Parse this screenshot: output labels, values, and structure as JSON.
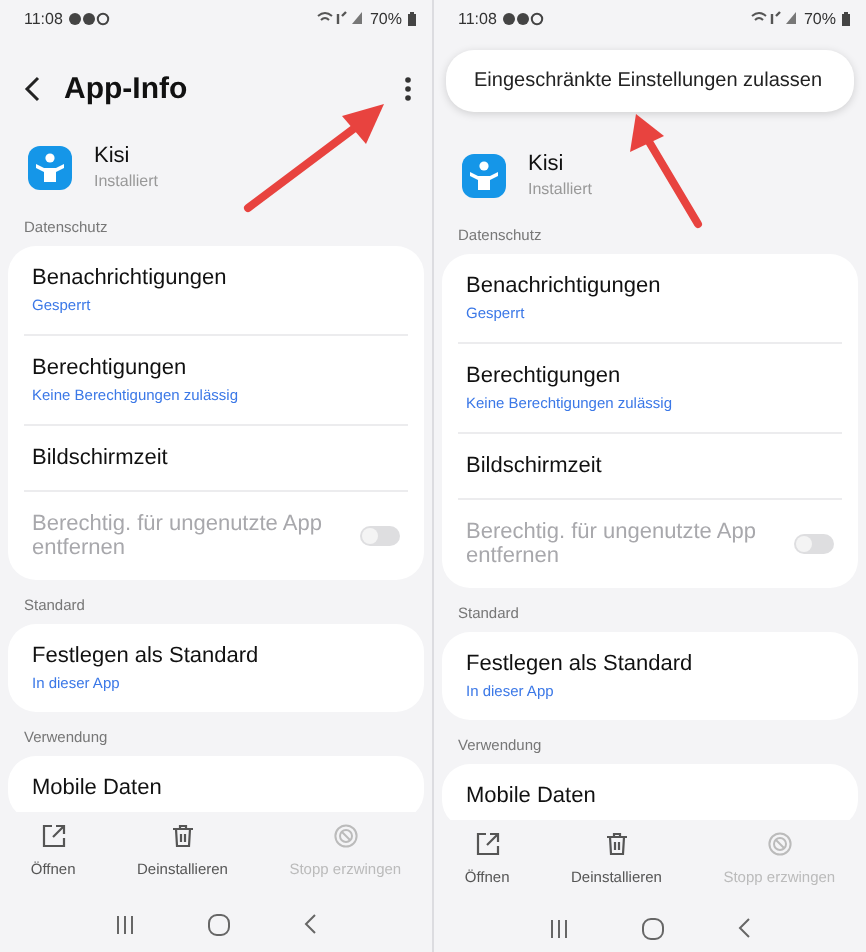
{
  "screens": [
    {
      "status_bar": {
        "time": "11:08",
        "battery": "70%"
      },
      "header": {
        "kind": "title",
        "title": "App-Info"
      },
      "arrow": true,
      "app": {
        "name": "Kisi",
        "status": "Installiert"
      },
      "sections": [
        {
          "label": "Datenschutz",
          "items": [
            {
              "kind": "link",
              "title": "Benachrichtigungen",
              "subtitle": "Gesperrt"
            },
            {
              "kind": "link",
              "title": "Berechtigungen",
              "subtitle": "Keine Berechtigungen zulässig"
            },
            {
              "kind": "link",
              "title": "Bildschirmzeit"
            },
            {
              "kind": "toggle",
              "title": "Berechtig. für ungenutzte App entfernen",
              "on": false,
              "disabled": true
            }
          ]
        },
        {
          "label": "Standard",
          "items": [
            {
              "kind": "link",
              "title": "Festlegen als Standard",
              "subtitle": "In dieser App"
            }
          ]
        },
        {
          "label": "Verwendung",
          "items": [
            {
              "kind": "link",
              "title": "Mobile Daten"
            }
          ]
        }
      ],
      "actions": [
        {
          "kind": "open",
          "label": "Öffnen",
          "disabled": false
        },
        {
          "kind": "uninstall",
          "label": "Deinstallieren",
          "disabled": false
        },
        {
          "kind": "stop",
          "label": "Stopp erzwingen",
          "disabled": true
        }
      ]
    },
    {
      "status_bar": {
        "time": "11:08",
        "battery": "70%"
      },
      "header": {
        "kind": "menu",
        "items": [
          "Eingeschränkte Einstellungen zulassen"
        ]
      },
      "arrow": true,
      "app": {
        "name": "Kisi",
        "status": "Installiert"
      },
      "sections": [
        {
          "label": "Datenschutz",
          "items": [
            {
              "kind": "link",
              "title": "Benachrichtigungen",
              "subtitle": "Gesperrt"
            },
            {
              "kind": "link",
              "title": "Berechtigungen",
              "subtitle": "Keine Berechtigungen zulässig"
            },
            {
              "kind": "link",
              "title": "Bildschirmzeit"
            },
            {
              "kind": "toggle",
              "title": "Berechtig. für ungenutzte App entfernen",
              "on": false,
              "disabled": true
            }
          ]
        },
        {
          "label": "Standard",
          "items": [
            {
              "kind": "link",
              "title": "Festlegen als Standard",
              "subtitle": "In dieser App"
            }
          ]
        },
        {
          "label": "Verwendung",
          "items": [
            {
              "kind": "link",
              "title": "Mobile Daten"
            }
          ]
        }
      ],
      "actions": [
        {
          "kind": "open",
          "label": "Öffnen",
          "disabled": false
        },
        {
          "kind": "uninstall",
          "label": "Deinstallieren",
          "disabled": false
        },
        {
          "kind": "stop",
          "label": "Stopp erzwingen",
          "disabled": true
        }
      ]
    }
  ]
}
